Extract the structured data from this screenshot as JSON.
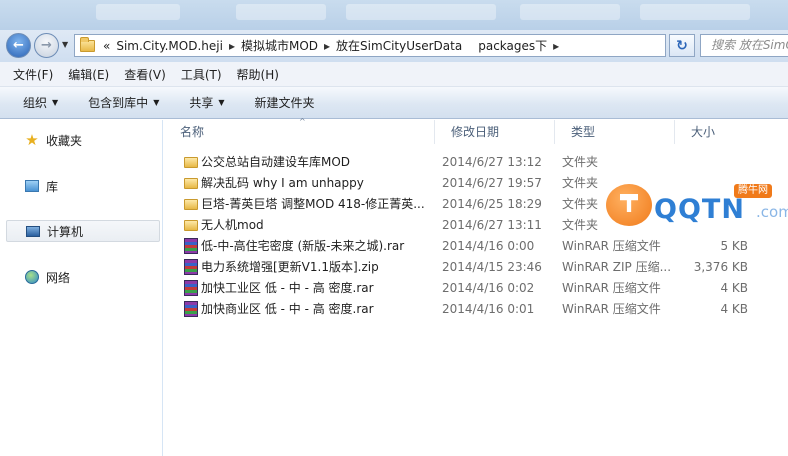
{
  "address": {
    "overflow": "«",
    "crumbs": [
      "Sim.City.MOD.heji",
      "模拟城市MOD",
      "放在SimCityUserData",
      "packages下"
    ],
    "search_placeholder": "搜索 放在SimCi"
  },
  "menu": [
    "文件(F)",
    "编辑(E)",
    "查看(V)",
    "工具(T)",
    "帮助(H)"
  ],
  "toolbar": {
    "organize": "组织",
    "include": "包含到库中",
    "share": "共享",
    "new_folder": "新建文件夹"
  },
  "nav": {
    "favorites": "收藏夹",
    "libraries": "库",
    "computer": "计算机",
    "network": "网络"
  },
  "columns": {
    "name": "名称",
    "date": "修改日期",
    "type": "类型",
    "size": "大小"
  },
  "files": [
    {
      "name": "公交总站自动建设车库MOD",
      "date": "2014/6/27 13:12",
      "type": "文件夹",
      "size": "",
      "icon": "folder-icon"
    },
    {
      "name": "解决乱码 why I am unhappy",
      "date": "2014/6/27 19:57",
      "type": "文件夹",
      "size": "",
      "icon": "folder-icon"
    },
    {
      "name": "巨塔-菁英巨塔 调整MOD 418-修正菁英...",
      "date": "2014/6/25 18:29",
      "type": "文件夹",
      "size": "",
      "icon": "folder-icon"
    },
    {
      "name": "无人机mod",
      "date": "2014/6/27 13:11",
      "type": "文件夹",
      "size": "",
      "icon": "folder-icon"
    },
    {
      "name": "低-中-高住宅密度 (新版-未来之城).rar",
      "date": "2014/4/16 0:00",
      "type": "WinRAR 压缩文件",
      "size": "5 KB",
      "icon": "winrar-icon"
    },
    {
      "name": "电力系统增强[更新V1.1版本].zip",
      "date": "2014/4/15 23:46",
      "type": "WinRAR ZIP 压缩...",
      "size": "3,376 KB",
      "icon": "winrar-icon"
    },
    {
      "name": "加快工业区 低 - 中 - 高 密度.rar",
      "date": "2014/4/16 0:02",
      "type": "WinRAR 压缩文件",
      "size": "4 KB",
      "icon": "winrar-icon"
    },
    {
      "name": "加快商业区 低 - 中 - 高 密度.rar",
      "date": "2014/4/16 0:01",
      "type": "WinRAR 压缩文件",
      "size": "4 KB",
      "icon": "winrar-icon"
    }
  ],
  "watermark": {
    "text": "QQTN",
    "suffix": ".com",
    "badge": "腾牛网"
  },
  "colors": {
    "link_blue": "#2f7fd4",
    "watermark_orange": "#f07a1a"
  }
}
